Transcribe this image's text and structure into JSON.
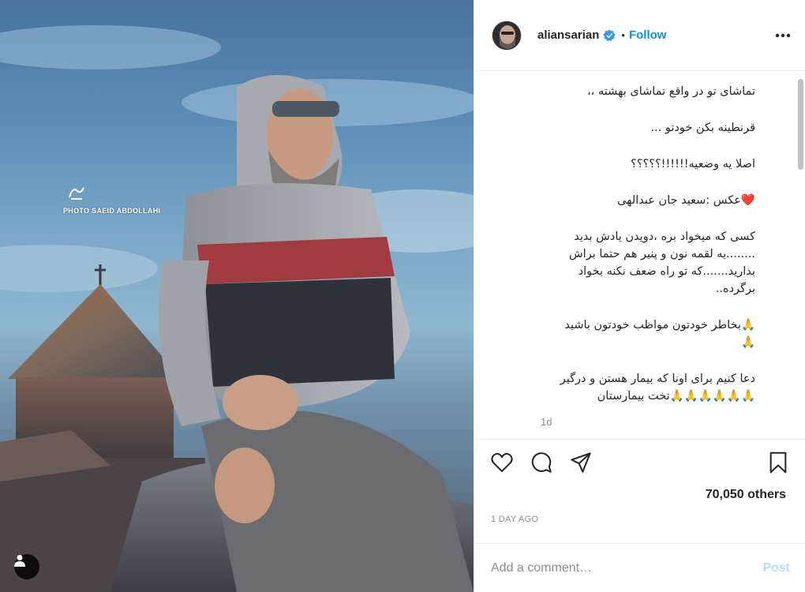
{
  "photo": {
    "credit_text": "PHOTO SAEID ABDOLLAHI",
    "user_tag_icon": "user-icon"
  },
  "header": {
    "username": "aliansarian",
    "verified_icon": "verified-badge-icon",
    "separator": "•",
    "follow_label": "Follow",
    "more_icon": "more-options-icon"
  },
  "caption": {
    "paragraphs": [
      "تماشای تو در واقع تماشای بهشته ،،",
      "قرنطینه بکن خودتو ...",
      "اصلا یه وضعیه!!!!!!؟؟؟؟؟",
      "❤️عکس :سعید جان عبدالهی",
      "کسی که میخواد بره ،دویدن یادش بدید\n........یه لقمه نون و پنیر هم حتما براش\nبذارید.......که تو راه ضعف نکنه بخواد\nبرگرده..",
      "🙏بخاطر خودتون مواظب خودتون باشید\n🙏",
      "دعا کنیم برای اونا که بیمار هستن و درگیر\n🙏🙏🙏🙏🙏🙏تخت بیمارستان"
    ],
    "time_ago": "1d"
  },
  "actions": {
    "like_icon": "heart-icon",
    "comment_icon": "comment-icon",
    "share_icon": "share-icon",
    "save_icon": "bookmark-icon"
  },
  "likes": "70,050 others",
  "date": "1 DAY AGO",
  "comment": {
    "placeholder": "Add a comment…",
    "post_label": "Post"
  },
  "colors": {
    "accent": "#0095f6",
    "post_disabled": "#b2dffc",
    "verified": "#3897f0"
  }
}
